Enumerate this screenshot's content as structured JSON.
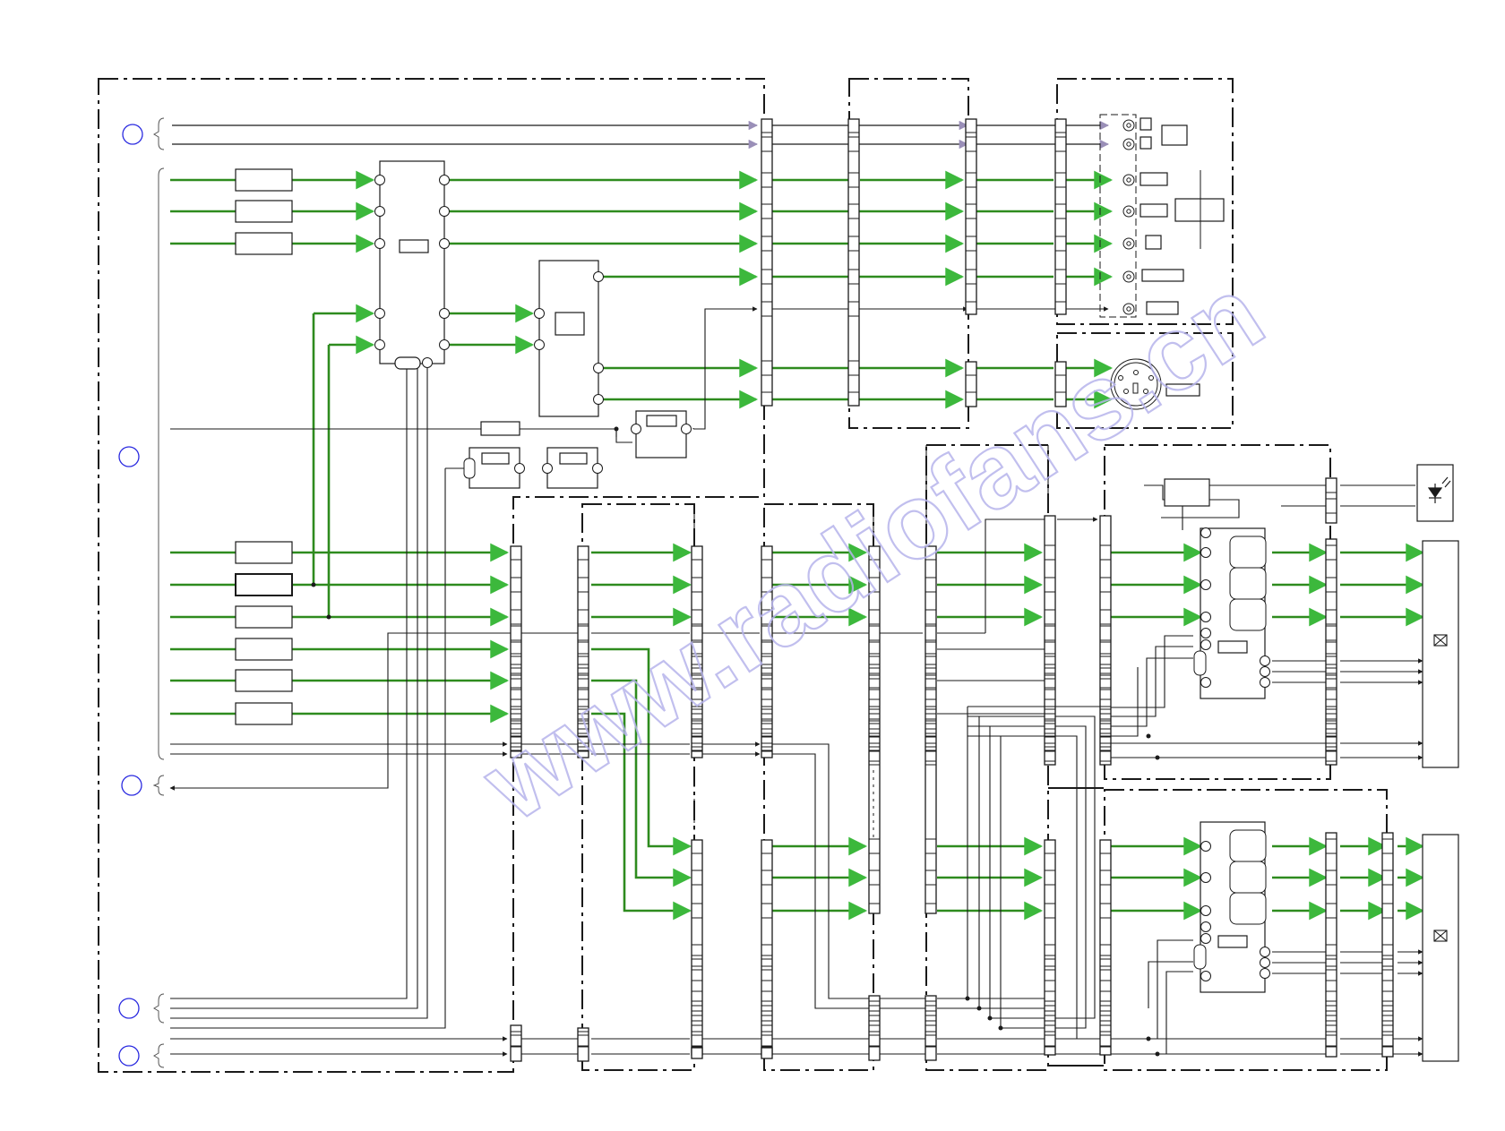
{
  "title": "",
  "colors": {
    "background": "#ffffff",
    "wire": "#1a1a1a",
    "signal": "#2e8b1e",
    "arrow": "#3cb83c",
    "grey_arrow": "#9a8fb8",
    "marker_circle": "#2a2ae0",
    "watermark": "#b7b4ec"
  },
  "markers": [
    {
      "id": "marker-1"
    },
    {
      "id": "marker-2"
    },
    {
      "id": "marker-3"
    },
    {
      "id": "marker-4"
    },
    {
      "id": "marker-5"
    }
  ],
  "watermark": {
    "text": "www.radiofans.cn",
    "kind": "watermark"
  }
}
